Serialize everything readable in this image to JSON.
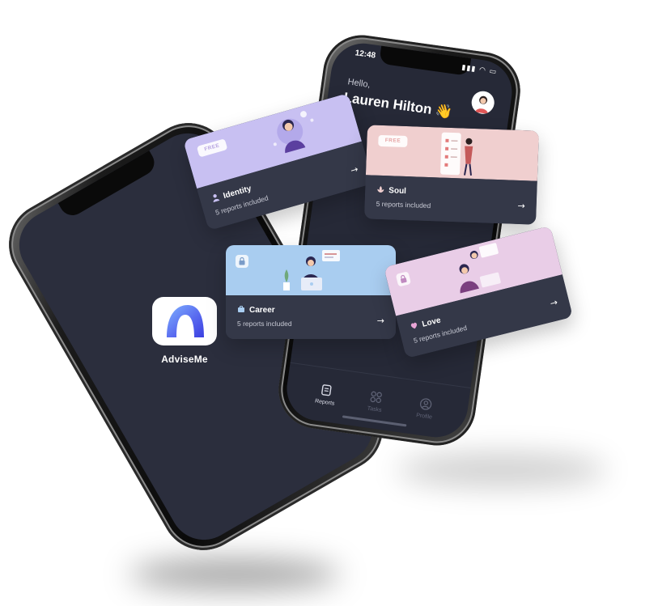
{
  "left_phone": {
    "app_name": "AdviseMe",
    "app_icon": "advise-me-logo-icon"
  },
  "right_phone": {
    "status_time": "12:48",
    "greeting": "Hello,",
    "user_name": "Lauren Hilton 👋",
    "tabs": [
      {
        "label": "Reports",
        "icon": "reports-icon",
        "active": true
      },
      {
        "label": "Tasks",
        "icon": "tasks-icon",
        "active": false
      },
      {
        "label": "Profile",
        "icon": "profile-icon",
        "active": false
      }
    ]
  },
  "cards": [
    {
      "key": "identity",
      "title": "Identity",
      "subtitle": "5 reports included",
      "badge": "FREE",
      "color": "#c8c0f2"
    },
    {
      "key": "soul",
      "title": "Soul",
      "subtitle": "5 reports included",
      "badge": "FREE",
      "color": "#f0cfcf"
    },
    {
      "key": "career",
      "title": "Career",
      "subtitle": "5 reports included",
      "badge": "",
      "color": "#a9cdf0"
    },
    {
      "key": "love",
      "title": "Love",
      "subtitle": "5 reports included",
      "badge": "",
      "color": "#e9cde7"
    }
  ],
  "arrow": "→"
}
